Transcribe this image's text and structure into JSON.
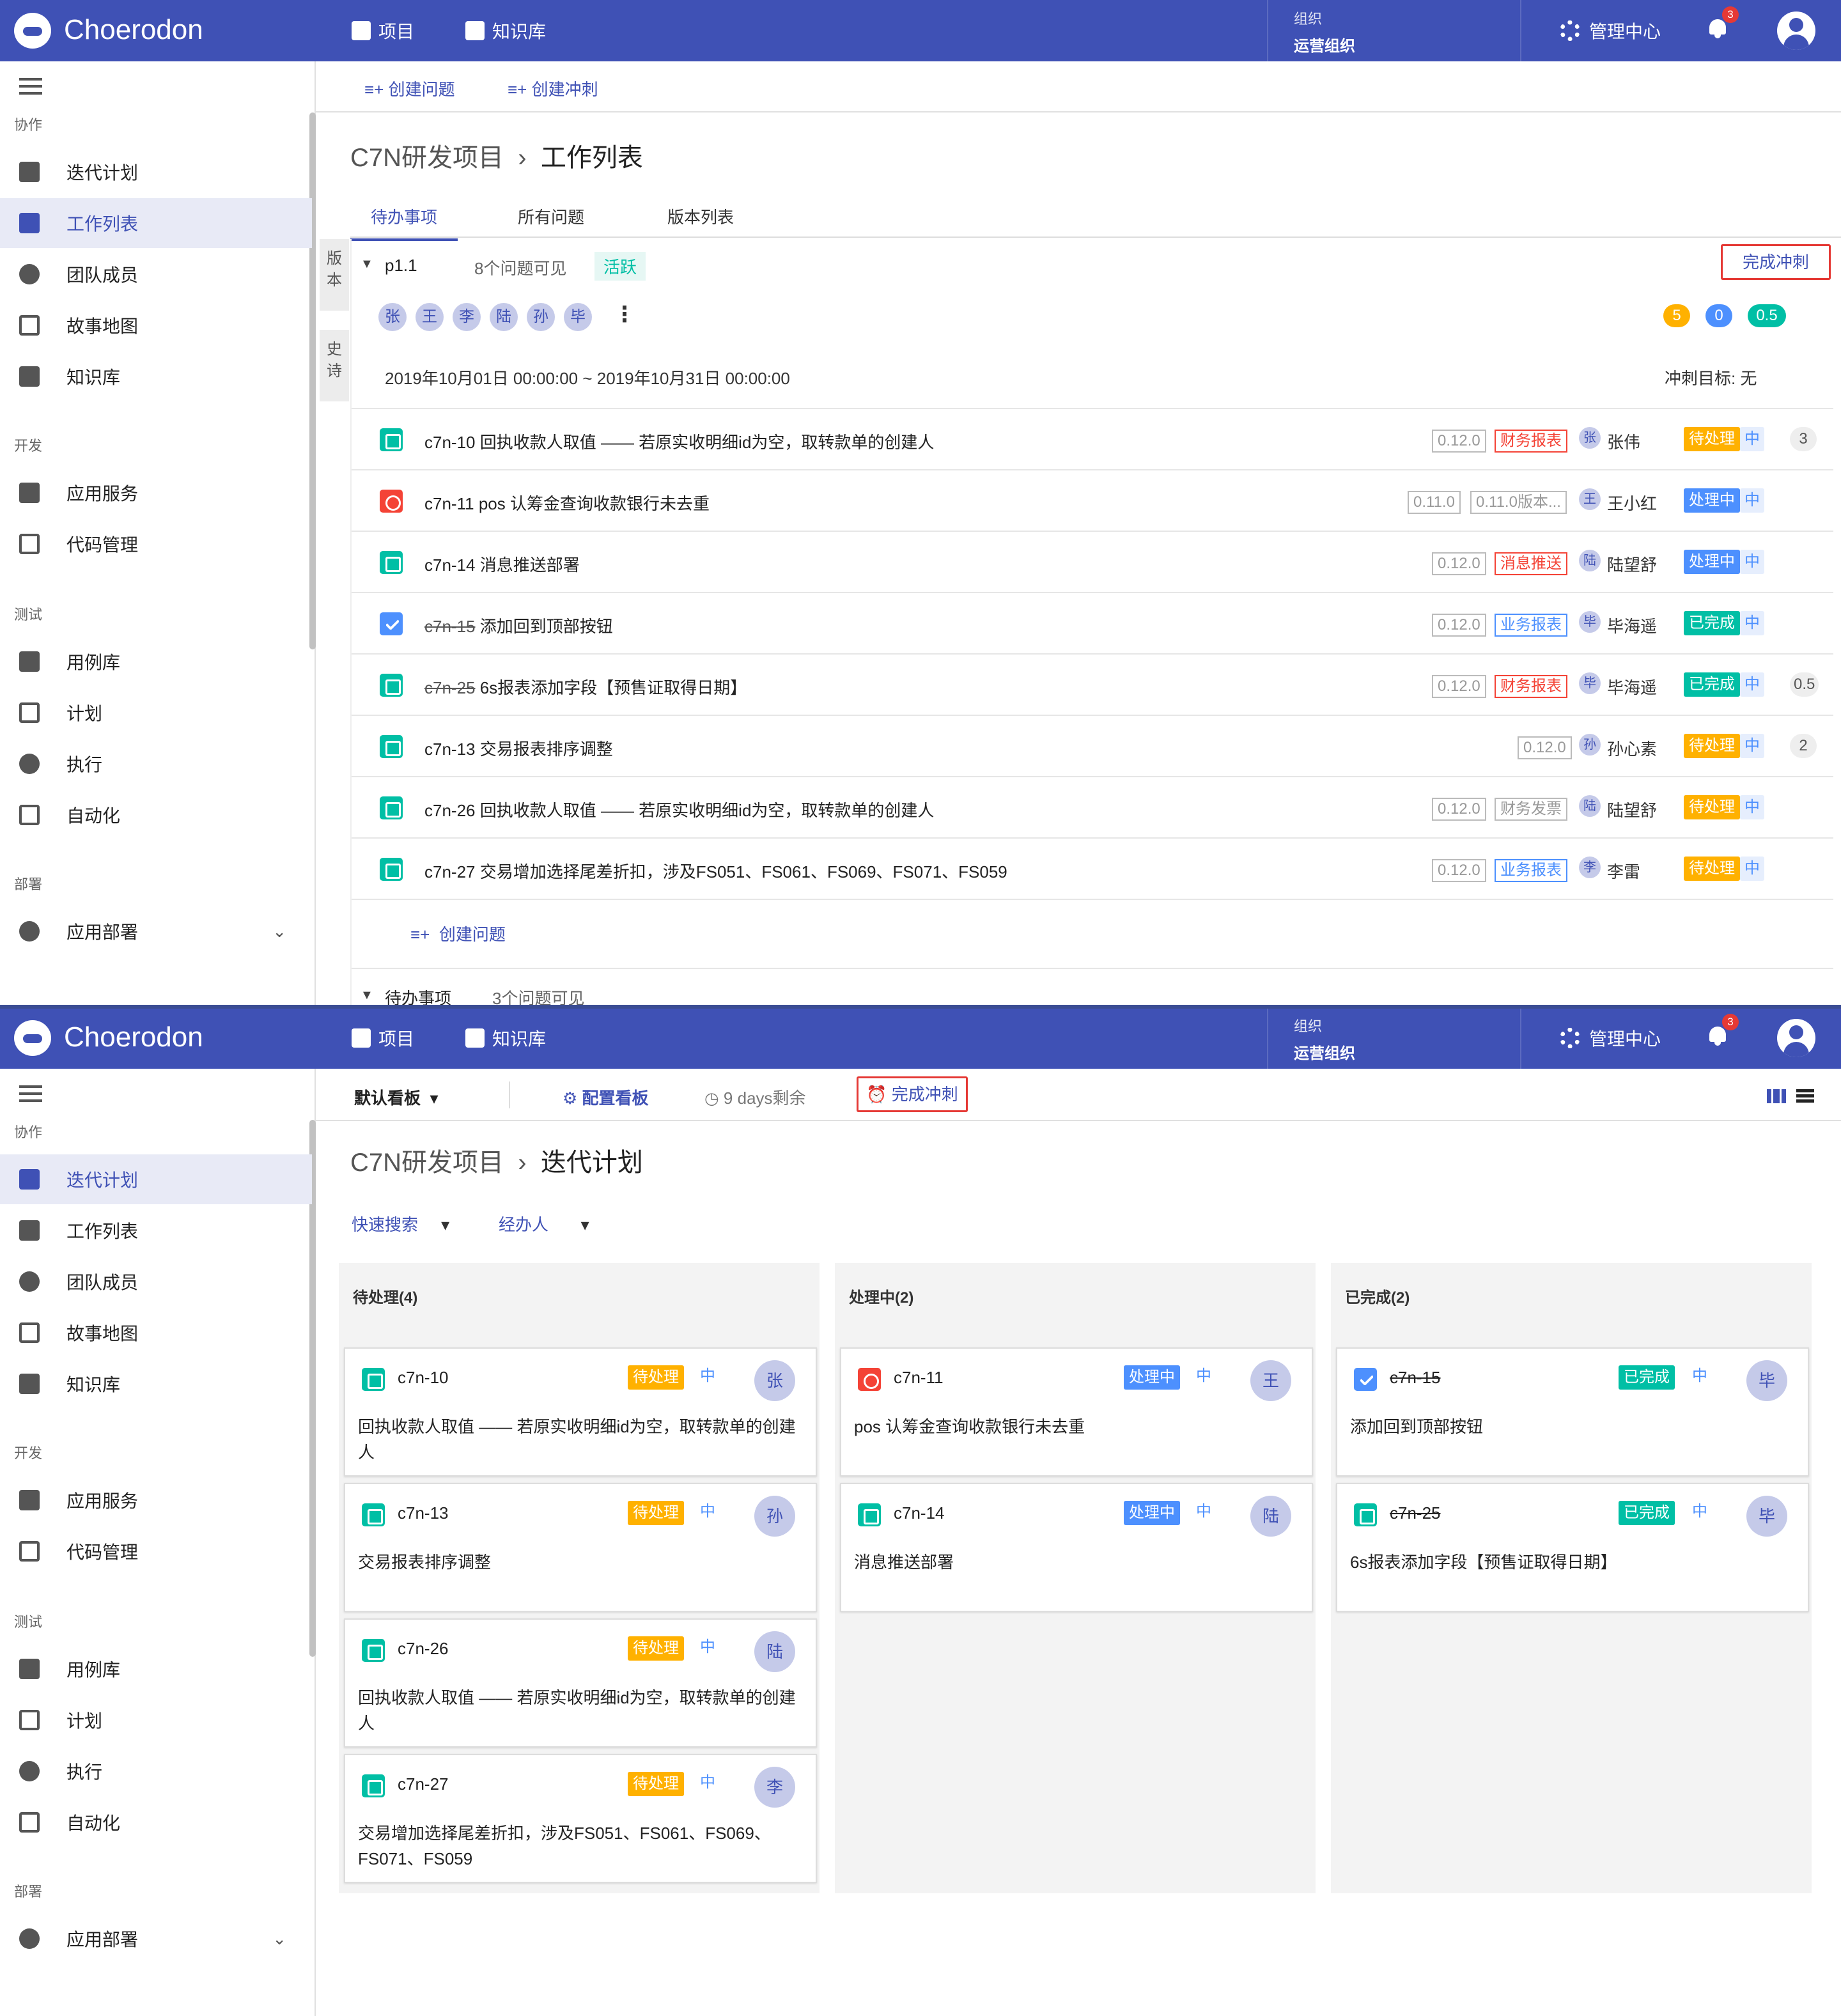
{
  "app": {
    "brand": "Choerodon",
    "nav_project": "项目",
    "nav_kb": "知识库",
    "org_label": "组织",
    "org_name": "运营组织",
    "manage": "管理中心",
    "notif_count": "3"
  },
  "sidebar": {
    "sec_collab": "协作",
    "sec_dev": "开发",
    "sec_test": "测试",
    "sec_deploy": "部署",
    "items": [
      "迭代计划",
      "工作列表",
      "团队成员",
      "故事地图",
      "知识库",
      "应用服务",
      "代码管理",
      "用例库",
      "计划",
      "执行",
      "自动化",
      "应用部署"
    ]
  },
  "backlog": {
    "create_issue": "创建问题",
    "create_sprint": "创建冲刺",
    "crumb_project": "C7N研发项目",
    "crumb_sep": "›",
    "crumb_page": "工作列表",
    "tabs": [
      "待办事项",
      "所有问题",
      "版本列表"
    ],
    "vtab_version": "版本",
    "vtab_epic": "史诗",
    "sprint_name": "p1.1",
    "sprint_count": "8个问题可见",
    "sprint_status": "活跃",
    "complete_btn": "完成冲刺",
    "members": [
      "张",
      "王",
      "李",
      "陆",
      "孙",
      "毕"
    ],
    "points": [
      "5",
      "0",
      "0.5"
    ],
    "dates": "2019年10月01日 00:00:00 ~ 2019年10月31日 00:00:00",
    "goal": "冲刺目标: 无",
    "issues": [
      {
        "key": "c7n-10",
        "title": "回执收款人取值 —— 若原实收明细id为空，取转款单的创建人",
        "version": "0.12.0",
        "label": "财务报表",
        "user": "张伟",
        "ua": "张",
        "status": "待处理",
        "pri": "中",
        "sp": "3"
      },
      {
        "key": "c7n-11",
        "title": "pos 认筹金查询收款银行未去重",
        "version": "0.11.0",
        "label": "0.11.0版本...",
        "user": "王小红",
        "ua": "王",
        "status": "处理中",
        "pri": "中",
        "sp": ""
      },
      {
        "key": "c7n-14",
        "title": "消息推送部署",
        "version": "0.12.0",
        "label": "消息推送",
        "user": "陆望舒",
        "ua": "陆",
        "status": "处理中",
        "pri": "中",
        "sp": ""
      },
      {
        "key": "c7n-15",
        "title": "添加回到顶部按钮",
        "version": "0.12.0",
        "label": "业务报表",
        "user": "毕海遥",
        "ua": "毕",
        "status": "已完成",
        "pri": "中",
        "sp": ""
      },
      {
        "key": "c7n-25",
        "title": "6s报表添加字段【预售证取得日期】",
        "version": "0.12.0",
        "label": "财务报表",
        "user": "毕海遥",
        "ua": "毕",
        "status": "已完成",
        "pri": "中",
        "sp": "0.5"
      },
      {
        "key": "c7n-13",
        "title": "交易报表排序调整",
        "version": "0.12.0",
        "label": "",
        "user": "孙心素",
        "ua": "孙",
        "status": "待处理",
        "pri": "中",
        "sp": "2"
      },
      {
        "key": "c7n-26",
        "title": "回执收款人取值 —— 若原实收明细id为空，取转款单的创建人",
        "version": "0.12.0",
        "label": "财务发票",
        "user": "陆望舒",
        "ua": "陆",
        "status": "待处理",
        "pri": "中",
        "sp": ""
      },
      {
        "key": "c7n-27",
        "title": "交易增加选择尾差折扣，涉及FS051、FS061、FS069、FS071、FS059",
        "version": "0.12.0",
        "label": "业务报表",
        "user": "李雷",
        "ua": "李",
        "status": "待处理",
        "pri": "中",
        "sp": ""
      }
    ],
    "add_issue": "创建问题",
    "backlog_name": "待办事项",
    "backlog_count": "3个问题可见"
  },
  "board": {
    "board_select": "默认看板",
    "config": "配置看板",
    "remain": "9 days剩余",
    "complete": "完成冲刺",
    "crumb_project": "C7N研发项目",
    "crumb_sep": "›",
    "crumb_page": "迭代计划",
    "quick_search": "快速搜索",
    "assignee": "经办人",
    "columns": [
      {
        "title": "待处理(4)",
        "cards": [
          {
            "key": "c7n-10",
            "status": "待处理",
            "pri": "中",
            "ua": "张",
            "text": "回执收款人取值 —— 若原实收明细id为空，取转款单的创建人"
          },
          {
            "key": "c7n-13",
            "status": "待处理",
            "pri": "中",
            "ua": "孙",
            "text": "交易报表排序调整"
          },
          {
            "key": "c7n-26",
            "status": "待处理",
            "pri": "中",
            "ua": "陆",
            "text": "回执收款人取值 —— 若原实收明细id为空，取转款单的创建人"
          },
          {
            "key": "c7n-27",
            "status": "待处理",
            "pri": "中",
            "ua": "李",
            "text": "交易增加选择尾差折扣，涉及FS051、FS061、FS069、FS071、FS059"
          }
        ]
      },
      {
        "title": "处理中(2)",
        "cards": [
          {
            "key": "c7n-11",
            "status": "处理中",
            "pri": "中",
            "ua": "王",
            "text": "pos 认筹金查询收款银行未去重"
          },
          {
            "key": "c7n-14",
            "status": "处理中",
            "pri": "中",
            "ua": "陆",
            "text": "消息推送部署"
          }
        ]
      },
      {
        "title": "已完成(2)",
        "cards": [
          {
            "key": "c7n-15",
            "status": "已完成",
            "pri": "中",
            "ua": "毕",
            "text": "添加回到顶部按钮"
          },
          {
            "key": "c7n-25",
            "status": "已完成",
            "pri": "中",
            "ua": "毕",
            "text": "6s报表添加字段【预售证取得日期】"
          }
        ]
      }
    ]
  },
  "colors": {
    "primary": "#3f51b5",
    "todo": "#ffb100",
    "doing": "#4d90fe",
    "done": "#00bfa5",
    "danger": "#f44336"
  }
}
